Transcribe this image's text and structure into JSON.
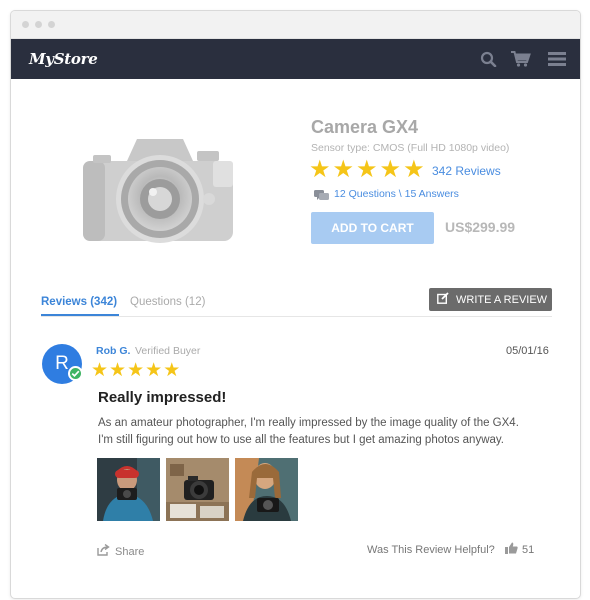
{
  "app": {
    "logo": "MyStore"
  },
  "nav": {
    "icons": [
      "search-icon",
      "cart-icon",
      "menu-icon"
    ]
  },
  "product": {
    "title": "Camera GX4",
    "sensor": "Sensor type: CMOS (Full HD 1080p video)",
    "rating": 5,
    "reviews_link": "342 Reviews",
    "qa_link": "12 Questions \\ 15 Answers",
    "add_to_cart": "ADD TO CART",
    "price": "US$299.99"
  },
  "tabs": {
    "reviews": "Reviews (342)",
    "questions": "Questions (12)"
  },
  "write_review": "WRITE A REVIEW",
  "review": {
    "avatar_initial": "R",
    "author": "Rob G.",
    "badge": "Verified Buyer",
    "date": "05/01/16",
    "rating": 5,
    "title": "Really impressed!",
    "body_line1": "As an amateur photographer, I'm really impressed by the image quality of the GX4.",
    "body_line2": "I'm still figuring out how to use all the features but I get amazing photos anyway.",
    "share": "Share",
    "helpful_question": "Was This Review Helpful?",
    "helpful_count": "51"
  },
  "colors": {
    "navbar": "#2a2f3e",
    "accent": "#3c85d8",
    "star": "#f5c518",
    "add_button": "#a8cbf2",
    "verified": "#3fb463"
  }
}
